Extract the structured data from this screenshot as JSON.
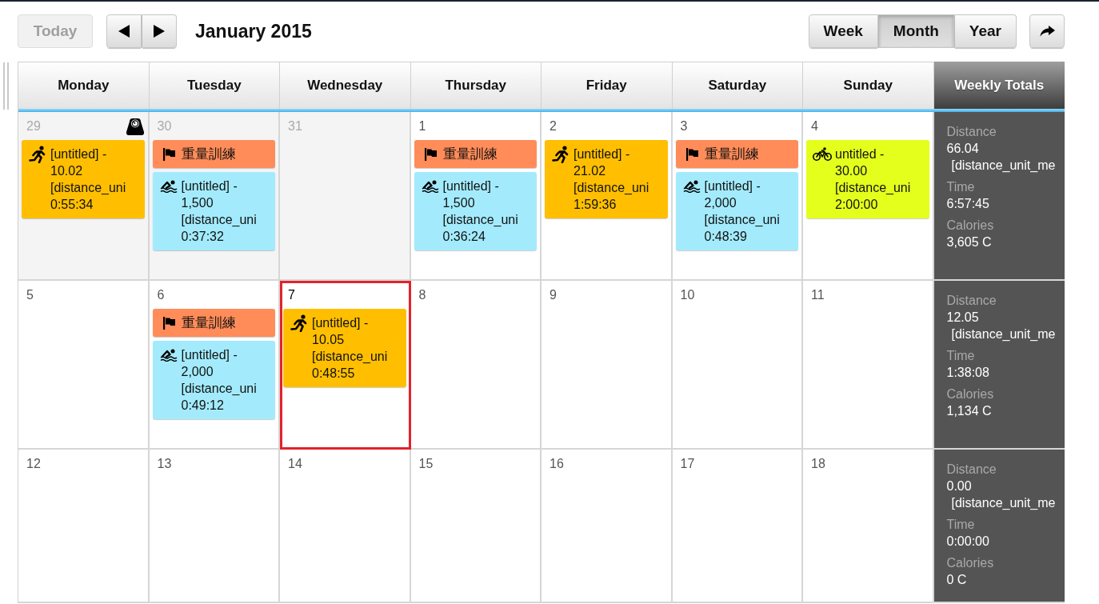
{
  "toolbar": {
    "today_button": {
      "label": "Today",
      "disabled": true
    },
    "title": "January 2015",
    "views": [
      {
        "label": "Week",
        "selected": false
      },
      {
        "label": "Month",
        "selected": true
      },
      {
        "label": "Year",
        "selected": false
      }
    ]
  },
  "header": {
    "days": [
      "Monday",
      "Tuesday",
      "Wednesday",
      "Thursday",
      "Friday",
      "Saturday",
      "Sunday"
    ],
    "totals": "Weekly Totals"
  },
  "weeks": [
    {
      "days": [
        {
          "number": "29",
          "outside_month": true,
          "selected": false,
          "weigh_in": true,
          "events": [
            {
              "kind": "run",
              "color": "#ffbf00",
              "title": "[untitled] -",
              "distance": "10.02",
              "unit": "[distance_uni",
              "duration": "0:55:34"
            }
          ]
        },
        {
          "number": "30",
          "outside_month": true,
          "selected": false,
          "weigh_in": false,
          "events": [
            {
              "kind": "strength",
              "color": "#ff8c59",
              "title": "重量訓練"
            },
            {
              "kind": "swim",
              "color": "#a3ebfc",
              "title": "[untitled] -",
              "distance": "1,500",
              "unit": "[distance_uni",
              "duration": "0:37:32"
            }
          ]
        },
        {
          "number": "31",
          "outside_month": true,
          "selected": false,
          "weigh_in": false
        },
        {
          "number": "1",
          "outside_month": false,
          "selected": false,
          "weigh_in": false,
          "events": [
            {
              "kind": "strength",
              "color": "#ff8c59",
              "title": "重量訓練"
            },
            {
              "kind": "swim",
              "color": "#a3ebfc",
              "title": "[untitled] -",
              "distance": "1,500",
              "unit": "[distance_uni",
              "duration": "0:36:24"
            }
          ]
        },
        {
          "number": "2",
          "outside_month": false,
          "selected": false,
          "weigh_in": false,
          "events": [
            {
              "kind": "run",
              "color": "#ffbf00",
              "title": "[untitled] -",
              "distance": "21.02",
              "unit": "[distance_uni",
              "duration": "1:59:36"
            }
          ]
        },
        {
          "number": "3",
          "outside_month": false,
          "selected": false,
          "weigh_in": false,
          "events": [
            {
              "kind": "strength",
              "color": "#ff8c59",
              "title": "重量訓練"
            },
            {
              "kind": "swim",
              "color": "#a3ebfc",
              "title": "[untitled] -",
              "distance": "2,000",
              "unit": "[distance_uni",
              "duration": "0:48:39"
            }
          ]
        },
        {
          "number": "4",
          "outside_month": false,
          "selected": false,
          "weigh_in": false,
          "events": [
            {
              "kind": "bike",
              "color": "#e4ff1c",
              "title": "untitled -",
              "distance": "30.00",
              "unit": "[distance_uni",
              "duration": "2:00:00"
            }
          ]
        }
      ],
      "totals": [
        {
          "label": "Distance",
          "value": "66.04",
          "unit": "[distance_unit_me"
        },
        {
          "label": "Time",
          "value": "6:57:45"
        },
        {
          "label": "Calories",
          "value": "3,605 C"
        }
      ]
    },
    {
      "days": [
        {
          "number": "5",
          "outside_month": false,
          "selected": false,
          "weigh_in": false
        },
        {
          "number": "6",
          "outside_month": false,
          "selected": false,
          "weigh_in": false,
          "events": [
            {
              "kind": "strength",
              "color": "#ff8c59",
              "title": "重量訓練"
            },
            {
              "kind": "swim",
              "color": "#a3ebfc",
              "title": "[untitled] -",
              "distance": "2,000",
              "unit": "[distance_uni",
              "duration": "0:49:12"
            }
          ]
        },
        {
          "number": "7",
          "outside_month": false,
          "selected": true,
          "weigh_in": false,
          "events": [
            {
              "kind": "run",
              "color": "#ffbf00",
              "title": "[untitled] -",
              "distance": "10.05",
              "unit": "[distance_uni",
              "duration": "0:48:55"
            }
          ]
        },
        {
          "number": "8",
          "outside_month": false,
          "selected": false,
          "weigh_in": false
        },
        {
          "number": "9",
          "outside_month": false,
          "selected": false,
          "weigh_in": false
        },
        {
          "number": "10",
          "outside_month": false,
          "selected": false,
          "weigh_in": false
        },
        {
          "number": "11",
          "outside_month": false,
          "selected": false,
          "weigh_in": false
        }
      ],
      "totals": [
        {
          "label": "Distance",
          "value": "12.05",
          "unit": "[distance_unit_me"
        },
        {
          "label": "Time",
          "value": "1:38:08"
        },
        {
          "label": "Calories",
          "value": "1,134 C"
        }
      ]
    },
    {
      "days": [
        {
          "number": "12",
          "outside_month": false,
          "selected": false,
          "weigh_in": false
        },
        {
          "number": "13",
          "outside_month": false,
          "selected": false,
          "weigh_in": false
        },
        {
          "number": "14",
          "outside_month": false,
          "selected": false,
          "weigh_in": false
        },
        {
          "number": "15",
          "outside_month": false,
          "selected": false,
          "weigh_in": false
        },
        {
          "number": "16",
          "outside_month": false,
          "selected": false,
          "weigh_in": false
        },
        {
          "number": "17",
          "outside_month": false,
          "selected": false,
          "weigh_in": false
        },
        {
          "number": "18",
          "outside_month": false,
          "selected": false,
          "weigh_in": false
        }
      ],
      "totals": [
        {
          "label": "Distance",
          "value": "0.00",
          "unit": "[distance_unit_me"
        },
        {
          "label": "Time",
          "value": "0:00:00"
        },
        {
          "label": "Calories",
          "value": "0 C"
        }
      ]
    }
  ]
}
